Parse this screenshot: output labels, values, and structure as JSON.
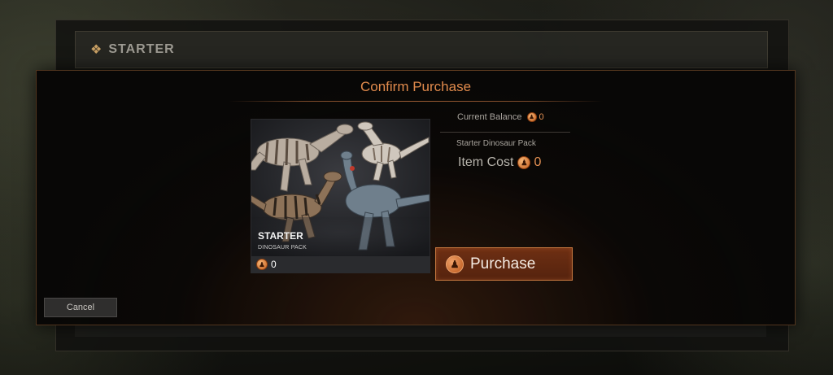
{
  "background": {
    "section_title": "STARTER"
  },
  "modal": {
    "title": "Confirm Purchase",
    "item": {
      "name": "STARTER",
      "subtitle": "DINOSAUR PACK",
      "price": "0"
    },
    "balance": {
      "label": "Current Balance",
      "value": "0"
    },
    "pack_name": "Starter Dinosaur Pack",
    "cost": {
      "label": "Item Cost",
      "value": "0"
    },
    "purchase_button": {
      "label": "Purchase"
    },
    "cancel_button": {
      "label": "Cancel"
    }
  },
  "colors": {
    "accent": "#e08a4c",
    "button_fill": "#6e2f13",
    "button_border": "#c6773f"
  },
  "icons": {
    "currency": "dinosaur-skull-coin-icon",
    "section": "fleur-icon"
  }
}
